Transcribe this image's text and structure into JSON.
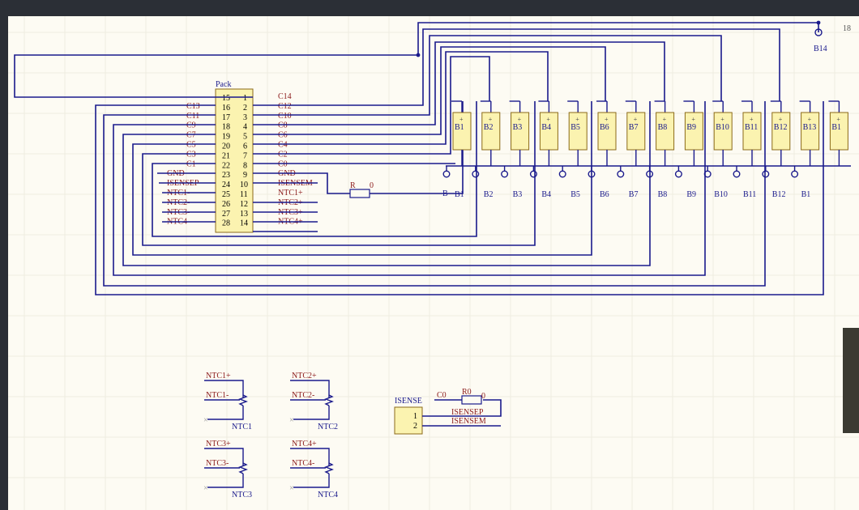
{
  "pack": {
    "title": "Pack",
    "left_nets": [
      "C13",
      "C11",
      "C9",
      "C7",
      "C5",
      "C3",
      "C1",
      "GND",
      "ISENSEP",
      "NTC1-",
      "NTC2-",
      "NTC3-",
      "NTC4-"
    ],
    "right_nets": [
      "C14",
      "C12",
      "C10",
      "C8",
      "C6",
      "C4",
      "C2",
      "C0",
      "GND",
      "ISENSEM",
      "NTC1+",
      "NTC2+",
      "NTC3+",
      "NTC4+"
    ],
    "left_pins": [
      "15",
      "16",
      "17",
      "18",
      "19",
      "20",
      "21",
      "22",
      "23",
      "24",
      "25",
      "26",
      "27",
      "28"
    ],
    "right_pins": [
      "1",
      "2",
      "3",
      "4",
      "5",
      "6",
      "7",
      "8",
      "9",
      "10",
      "11",
      "12",
      "13",
      "14"
    ]
  },
  "resistor_r": {
    "name": "R",
    "value": "0"
  },
  "b_node_label": "B",
  "cells": [
    {
      "label": "B1"
    },
    {
      "label": "B2"
    },
    {
      "label": "B3"
    },
    {
      "label": "B4"
    },
    {
      "label": "B5"
    },
    {
      "label": "B6"
    },
    {
      "label": "B7"
    },
    {
      "label": "B8"
    },
    {
      "label": "B9"
    },
    {
      "label": "B10"
    },
    {
      "label": "B11"
    },
    {
      "label": "B12"
    },
    {
      "label": "B13"
    },
    {
      "label": "B1"
    }
  ],
  "terminals": [
    "B1",
    "B2",
    "B3",
    "B4",
    "B5",
    "B6",
    "B7",
    "B8",
    "B9",
    "B10",
    "B11",
    "B12",
    "B1"
  ],
  "top_right": {
    "b14": "B14",
    "corner": "18"
  },
  "ntc": [
    {
      "plus": "NTC1+",
      "minus": "NTC1-",
      "name": "NTC1"
    },
    {
      "plus": "NTC2+",
      "minus": "NTC2-",
      "name": "NTC2"
    },
    {
      "plus": "NTC3+",
      "minus": "NTC3-",
      "name": "NTC3"
    },
    {
      "plus": "NTC4+",
      "minus": "NTC4-",
      "name": "NTC4"
    }
  ],
  "isense": {
    "title": "ISENSE",
    "net_c0": "C0",
    "r0_name": "R0",
    "r0_value": "0",
    "pin1": "1",
    "pin2": "2",
    "net_p": "ISENSEP",
    "net_m": "ISENSEM"
  },
  "colors": {
    "wire": "#1a1a8c",
    "net_label": "#8b1a1a",
    "component_fill": "#fbf3b0",
    "component_stroke": "#8b6a1a"
  }
}
